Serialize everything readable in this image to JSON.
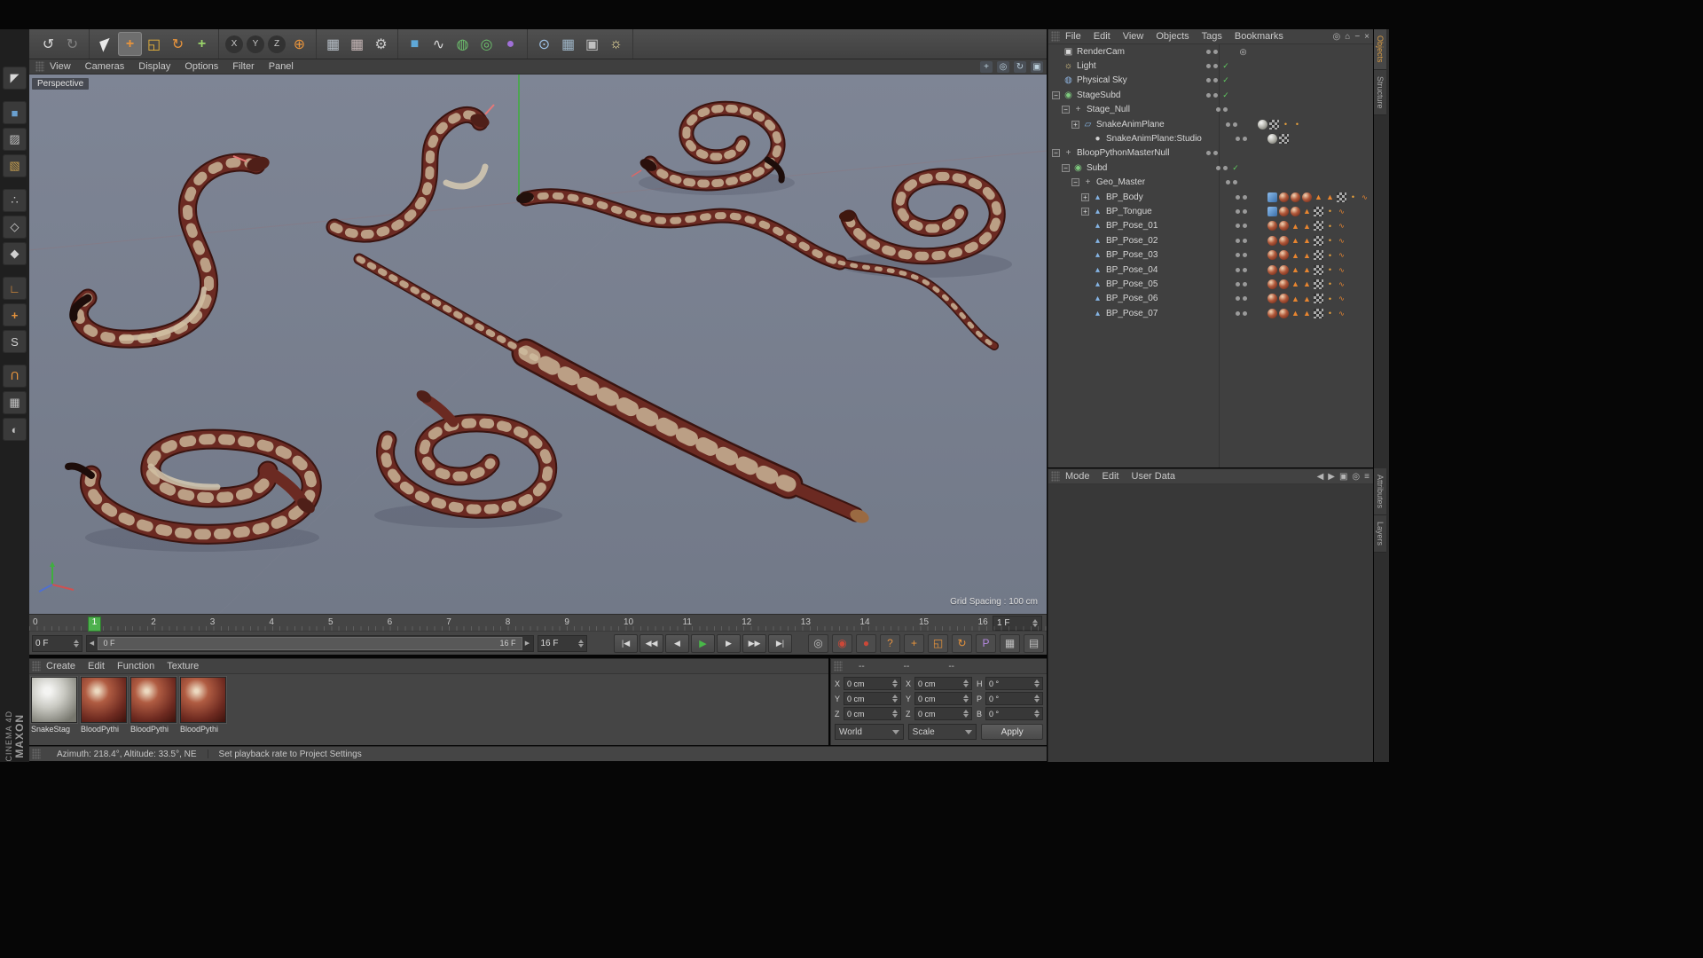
{
  "colors": {
    "viewport_bg_top": "#7e8595",
    "viewport_bg_bot": "#727988",
    "accent_orange": "#e8943c",
    "play_green": "#49b849",
    "marker_green": "#4db04d",
    "snake_body": "#6b2a22",
    "snake_pattern": "#cfbd9f"
  },
  "branding": {
    "maxon": "MAXON",
    "cinema": "CINEMA 4D"
  },
  "top_toolbar": {
    "groups": [
      [
        {
          "name": "undo-icon",
          "glyph": "↺",
          "color": "#d8d8d8"
        },
        {
          "name": "redo-icon",
          "glyph": "↻",
          "color": "#d8d8d8",
          "dim": true
        }
      ],
      [
        {
          "name": "live-selection-icon",
          "glyph": "◤",
          "color": "#e8e8e8"
        },
        {
          "name": "move-tool-icon",
          "glyph": "+",
          "color": "#e8943c",
          "active": true,
          "bold": true
        },
        {
          "name": "scale-tool-icon",
          "glyph": "◱",
          "color": "#e8b43c"
        },
        {
          "name": "rotate-tool-icon",
          "glyph": "↻",
          "color": "#e8943c"
        },
        {
          "name": "last-tool-icon",
          "glyph": "+",
          "color": "#9ad46a",
          "bold": true
        }
      ],
      [
        {
          "name": "lock-x-icon",
          "glyph": "X",
          "circle": true
        },
        {
          "name": "lock-y-icon",
          "glyph": "Y",
          "circle": true
        },
        {
          "name": "lock-z-icon",
          "glyph": "Z",
          "circle": true
        },
        {
          "name": "coord-system-icon",
          "glyph": "⊕",
          "color": "#e8943c"
        }
      ],
      [
        {
          "name": "render-view-icon",
          "glyph": "▦",
          "color": "#b8c0c8"
        },
        {
          "name": "render-picture-viewer-icon",
          "glyph": "▦",
          "color": "#c8b8b8"
        },
        {
          "name": "render-settings-icon",
          "glyph": "⚙",
          "color": "#c8c8c8"
        }
      ],
      [
        {
          "name": "cube-primitive-icon",
          "glyph": "■",
          "color": "#5fa8d8"
        },
        {
          "name": "spline-pen-icon",
          "glyph": "∿",
          "color": "#d8d8d8"
        },
        {
          "name": "subdivision-surface-icon",
          "glyph": "◍",
          "color": "#6cc06c"
        },
        {
          "name": "array-modifier-icon",
          "glyph": "◎",
          "color": "#6cc06c"
        },
        {
          "name": "deformer-icon",
          "glyph": "●",
          "color": "#a070d8"
        }
      ],
      [
        {
          "name": "environment-icon",
          "glyph": "⊙",
          "color": "#9fc3e8"
        },
        {
          "name": "table-view-icon",
          "glyph": "▦",
          "color": "#9fb6c8"
        },
        {
          "name": "camera-icon",
          "glyph": "▣",
          "color": "#c0c0c0"
        },
        {
          "name": "light-icon",
          "glyph": "☼",
          "color": "#f0e0a0"
        }
      ]
    ]
  },
  "left_toolbar": {
    "icons": [
      {
        "name": "make-editable-icon",
        "glyph": "◤",
        "color": "#d8d8d8"
      },
      {
        "name": "model-mode-icon",
        "glyph": "■",
        "color": "#6aa0d0",
        "gap": true
      },
      {
        "name": "texture-mode-icon",
        "glyph": "▨",
        "color": "#c0c0c0"
      },
      {
        "name": "workplane-mode-icon",
        "glyph": "▧",
        "color": "#c8a050"
      },
      {
        "name": "points-mode-icon",
        "glyph": "∴",
        "color": "#d0d0d0",
        "gap": true
      },
      {
        "name": "edges-mode-icon",
        "glyph": "◇",
        "color": "#d0d0d0"
      },
      {
        "name": "polygons-mode-icon",
        "glyph": "◆",
        "color": "#d0d0d0"
      },
      {
        "name": "enable-axis-icon",
        "glyph": "∟",
        "color": "#e8943c",
        "gap": true
      },
      {
        "name": "axis-modification-icon",
        "glyph": "+",
        "color": "#e8943c",
        "bold": true
      },
      {
        "name": "snap-icon",
        "glyph": "S",
        "color": "#d0d0d0"
      },
      {
        "name": "magnet-icon",
        "glyph": "U",
        "color": "#e8943c",
        "rotate": 180,
        "gap": true
      },
      {
        "name": "workplane-lock-icon",
        "glyph": "▦",
        "color": "#c0c0c0"
      },
      {
        "name": "solo-mode-icon",
        "glyph": "◐",
        "color": "#c0c0c0"
      }
    ]
  },
  "viewport": {
    "menu": [
      "View",
      "Cameras",
      "Display",
      "Options",
      "Filter",
      "Panel"
    ],
    "view_icons": [
      {
        "name": "pan-view-icon",
        "glyph": "+"
      },
      {
        "name": "zoom-view-icon",
        "glyph": "◎"
      },
      {
        "name": "rotate-view-icon",
        "glyph": "↻"
      },
      {
        "name": "toggle-view-icon",
        "glyph": "▣"
      }
    ],
    "view_label": "Perspective",
    "grid_spacing": "Grid Spacing : 100 cm"
  },
  "object_manager": {
    "menu": [
      "File",
      "Edit",
      "View",
      "Objects",
      "Tags",
      "Bookmarks"
    ],
    "right_icons": [
      {
        "name": "search-icon",
        "glyph": "◎"
      },
      {
        "name": "home-icon",
        "glyph": "⌂"
      },
      {
        "name": "minimize-icon",
        "glyph": "−"
      },
      {
        "name": "close-icon",
        "glyph": "×"
      }
    ],
    "rows": [
      {
        "label": "RenderCam",
        "level": 0,
        "icon": "camera",
        "tags": [
          "target"
        ]
      },
      {
        "label": "Light",
        "level": 0,
        "icon": "light",
        "state": "check"
      },
      {
        "label": "Physical Sky",
        "level": 0,
        "icon": "sky",
        "state": "check"
      },
      {
        "label": "StageSubd",
        "level": 0,
        "icon": "subd",
        "expand": "minus",
        "state": "check"
      },
      {
        "label": "Stage_Null",
        "level": 1,
        "icon": "null",
        "expand": "minus"
      },
      {
        "label": "SnakeAnimPlane",
        "level": 2,
        "icon": "plane",
        "expand": "plus",
        "tags": [
          "matg",
          "checker",
          "dot",
          "dot"
        ]
      },
      {
        "label": "SnakeAnimPlane:Studio",
        "level": 3,
        "icon": "mat",
        "tags": [
          "matg",
          "checker"
        ]
      },
      {
        "label": "BloopPythonMasterNull",
        "level": 0,
        "icon": "null",
        "expand": "minus"
      },
      {
        "label": "Subd",
        "level": 1,
        "icon": "subd",
        "expand": "minus",
        "state": "check"
      },
      {
        "label": "Geo_Master",
        "level": 2,
        "icon": "null",
        "expand": "minus"
      },
      {
        "label": "BP_Body",
        "level": 3,
        "icon": "mesh",
        "expand": "plus",
        "tags": [
          "uv",
          "mat",
          "mat",
          "mat",
          "tri",
          "tri",
          "checker",
          "dot",
          "wave"
        ]
      },
      {
        "label": "BP_Tongue",
        "level": 3,
        "icon": "mesh",
        "expand": "plus",
        "tags": [
          "uv",
          "mat",
          "mat",
          "tri",
          "checker",
          "dot",
          "wave"
        ]
      },
      {
        "label": "BP_Pose_01",
        "level": 3,
        "icon": "mesh",
        "tags": [
          "mat",
          "mat",
          "tri",
          "tri",
          "checker",
          "dot",
          "wave"
        ]
      },
      {
        "label": "BP_Pose_02",
        "level": 3,
        "icon": "mesh",
        "tags": [
          "mat",
          "mat",
          "tri",
          "tri",
          "checker",
          "dot",
          "wave"
        ]
      },
      {
        "label": "BP_Pose_03",
        "level": 3,
        "icon": "mesh",
        "tags": [
          "mat",
          "mat",
          "tri",
          "tri",
          "checker",
          "dot",
          "wave"
        ]
      },
      {
        "label": "BP_Pose_04",
        "level": 3,
        "icon": "mesh",
        "tags": [
          "mat",
          "mat",
          "tri",
          "tri",
          "checker",
          "dot",
          "wave"
        ]
      },
      {
        "label": "BP_Pose_05",
        "level": 3,
        "icon": "mesh",
        "tags": [
          "mat",
          "mat",
          "tri",
          "tri",
          "checker",
          "dot",
          "wave"
        ]
      },
      {
        "label": "BP_Pose_06",
        "level": 3,
        "icon": "mesh",
        "tags": [
          "mat",
          "mat",
          "tri",
          "tri",
          "checker",
          "dot",
          "wave"
        ]
      },
      {
        "label": "BP_Pose_07",
        "level": 3,
        "icon": "mesh",
        "tags": [
          "mat",
          "mat",
          "tri",
          "tri",
          "checker",
          "dot",
          "wave"
        ]
      }
    ]
  },
  "attribute_manager": {
    "menu": [
      "Mode",
      "Edit",
      "User Data"
    ],
    "right_icons": [
      {
        "name": "nav-back-icon",
        "glyph": "◀"
      },
      {
        "name": "nav-forward-icon",
        "glyph": "▶"
      },
      {
        "name": "lock-icon",
        "glyph": "▣"
      },
      {
        "name": "pin-icon",
        "glyph": "◎"
      },
      {
        "name": "panel-menu-icon",
        "glyph": "≡"
      }
    ]
  },
  "side_tabs": {
    "top": [
      "Objects",
      "Structure"
    ],
    "bottom": [
      "Attributes",
      "Layers"
    ]
  },
  "timeline": {
    "ticks": [
      "0",
      "1",
      "2",
      "3",
      "4",
      "5",
      "6",
      "7",
      "8",
      "9",
      "10",
      "11",
      "12",
      "13",
      "14",
      "15",
      "16"
    ],
    "current_frame": "1 F",
    "start_field": "0 F",
    "range_start": "0 F",
    "range_end": "16 F",
    "end_field": "16 F",
    "transport": [
      {
        "name": "goto-start-button",
        "glyph": "|◀"
      },
      {
        "name": "previous-key-button",
        "glyph": "◀◀"
      },
      {
        "name": "previous-frame-button",
        "glyph": "◀"
      },
      {
        "name": "play-button",
        "glyph": "▶",
        "accent": true
      },
      {
        "name": "next-frame-button",
        "glyph": "▶"
      },
      {
        "name": "next-key-button",
        "glyph": "▶▶"
      },
      {
        "name": "goto-end-button",
        "glyph": "▶|"
      }
    ],
    "key_icons": [
      {
        "name": "keyframe-ghost-icon",
        "glyph": "◎",
        "color": "#c0c0c0"
      },
      {
        "name": "record-keyframe-icon",
        "glyph": "◉",
        "color": "#cc4838"
      },
      {
        "name": "autokey-icon",
        "glyph": "●",
        "color": "#cc4838"
      },
      {
        "name": "help-icon",
        "glyph": "?",
        "color": "#e09040"
      },
      {
        "name": "key-position-icon",
        "glyph": "+",
        "color": "#e8943c"
      },
      {
        "name": "key-scale-icon",
        "glyph": "◱",
        "color": "#e8943c"
      },
      {
        "name": "key-rotation-icon",
        "glyph": "↻",
        "color": "#e8943c"
      },
      {
        "name": "key-parameter-icon",
        "glyph": "P",
        "color": "#b488e0"
      },
      {
        "name": "key-pla-icon",
        "glyph": "▦",
        "color": "#c0c0c0"
      },
      {
        "name": "layout-grid-icon",
        "glyph": "▤",
        "color": "#c0c0c0"
      }
    ]
  },
  "materials_panel": {
    "menu": [
      "Create",
      "Edit",
      "Function",
      "Texture"
    ],
    "materials": [
      {
        "name": "SnakeStag",
        "kind": "gray"
      },
      {
        "name": "BloodPythi",
        "kind": "red"
      },
      {
        "name": "BloodPythi",
        "kind": "red"
      },
      {
        "name": "BloodPythi",
        "kind": "red"
      }
    ]
  },
  "coordinates_panel": {
    "header": [
      "--",
      "--",
      "--"
    ],
    "groups": [
      {
        "fields": [
          {
            "label": "X",
            "value": "0 cm"
          },
          {
            "label": "Y",
            "value": "0 cm"
          },
          {
            "label": "Z",
            "value": "0 cm"
          }
        ]
      },
      {
        "fields": [
          {
            "label": "X",
            "value": "0 cm"
          },
          {
            "label": "Y",
            "value": "0 cm"
          },
          {
            "label": "Z",
            "value": "0 cm"
          }
        ]
      },
      {
        "fields": [
          {
            "label": "H",
            "value": "0 °"
          },
          {
            "label": "P",
            "value": "0 °"
          },
          {
            "label": "B",
            "value": "0 °"
          }
        ]
      }
    ],
    "mode_dropdown": "World",
    "scale_dropdown": "Scale",
    "apply_label": "Apply"
  },
  "status_bar": {
    "left": "Azimuth: 218.4°, Altitude: 33.5°, NE",
    "right": "Set playback rate to Project Settings"
  }
}
